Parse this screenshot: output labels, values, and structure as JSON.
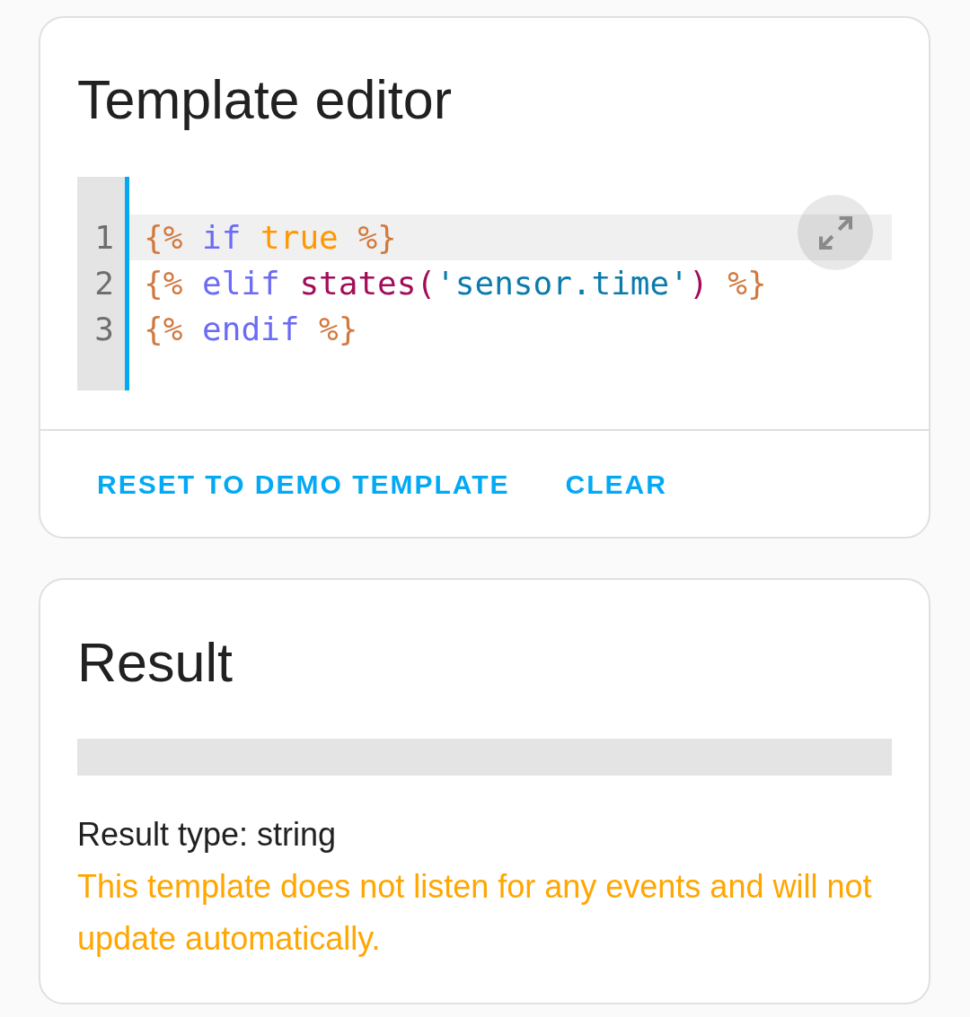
{
  "template_editor": {
    "title": "Template editor",
    "editor": {
      "lines": [
        {
          "number": "1",
          "active": true,
          "tokens": [
            {
              "kind": "delimiter",
              "text": "{%"
            },
            {
              "kind": "keyword",
              "text": " if"
            },
            {
              "kind": "atom",
              "text": " true"
            },
            {
              "kind": "delimiter",
              "text": " %}"
            }
          ]
        },
        {
          "number": "2",
          "active": false,
          "tokens": [
            {
              "kind": "delimiter",
              "text": "{%"
            },
            {
              "kind": "keyword",
              "text": " elif"
            },
            {
              "kind": "function",
              "text": " states("
            },
            {
              "kind": "string",
              "text": "'sensor.time'"
            },
            {
              "kind": "function",
              "text": ")"
            },
            {
              "kind": "delimiter",
              "text": " %}"
            }
          ]
        },
        {
          "number": "3",
          "active": false,
          "tokens": [
            {
              "kind": "delimiter",
              "text": "{%"
            },
            {
              "kind": "keyword",
              "text": " endif"
            },
            {
              "kind": "delimiter",
              "text": " %}"
            }
          ]
        }
      ]
    },
    "actions": [
      {
        "label": "RESET TO DEMO TEMPLATE"
      },
      {
        "label": "CLEAR"
      }
    ]
  },
  "result": {
    "title": "Result",
    "result_type": "Result type: string",
    "warning": "This template does not listen for any events and will not update automatically."
  }
}
